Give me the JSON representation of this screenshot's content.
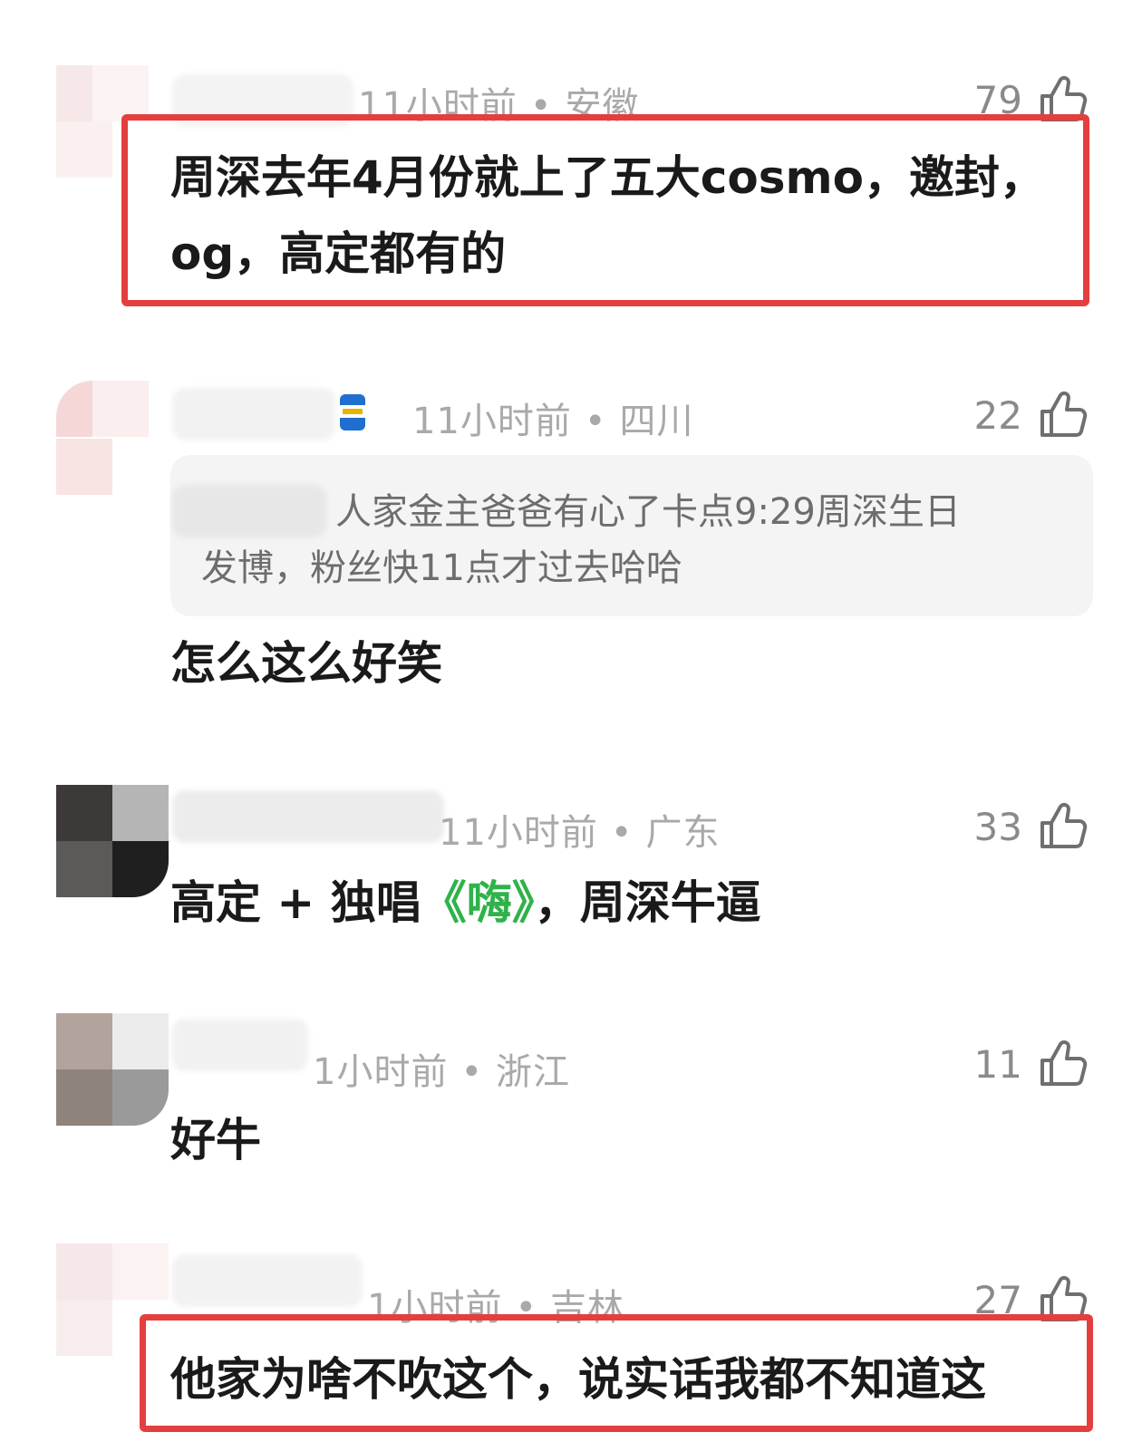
{
  "comments": [
    {
      "time": "11小时前",
      "region": "安徽",
      "likes": "79",
      "text_line1": "周深去年4月份就上了五大cosmo，邀封，",
      "text_line2": "og，高定都有的",
      "highlighted": true
    },
    {
      "time": "11小时前",
      "region": "四川",
      "likes": "22",
      "quote_line1": "人家金主爸爸有心了卡点9:29周深生日",
      "quote_line2": "发博，粉丝快11点才过去哈哈",
      "text": "怎么这么好笑"
    },
    {
      "time": "11小时前",
      "region": "广东",
      "likes": "33",
      "text_before": "高定 + 独唱",
      "text_green": "《嗨》",
      "text_after": "，周深牛逼"
    },
    {
      "time": "1小时前",
      "region": "浙江",
      "likes": "11",
      "text": "好牛"
    },
    {
      "time": "1小时前",
      "region": "吉林",
      "likes": "27",
      "text": "他家为啥不吹这个，说实话我都不知道这",
      "highlighted": true
    }
  ],
  "separator": "•",
  "colors": {
    "highlight": "#e53e3e",
    "green_text": "#2fb24a",
    "meta": "#a9a9a9"
  },
  "icons": {
    "like": "thumbs-up-icon",
    "badge": "drink-can-icon"
  }
}
